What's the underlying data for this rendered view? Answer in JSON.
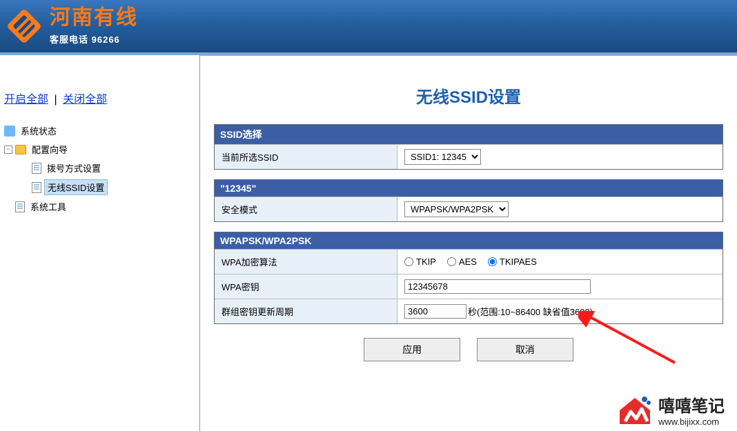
{
  "header": {
    "brand": "河南有线",
    "hotline_label": "客服电话",
    "hotline_number": "96266"
  },
  "sidebar": {
    "expand_all": "开启全部",
    "collapse_all": "关闭全部",
    "nodes": {
      "status": "系统状态",
      "wizard": "配置向导",
      "dial": "拨号方式设置",
      "ssid": "无线SSID设置",
      "tools": "系统工具"
    }
  },
  "main": {
    "title": "无线SSID设置",
    "panel_ssid": {
      "heading": "SSID选择",
      "rows": {
        "current_ssid_label": "当前所选SSID",
        "current_ssid_value": "SSID1: 12345"
      }
    },
    "panel_sec": {
      "heading": "\"12345\"",
      "rows": {
        "sec_mode_label": "安全模式",
        "sec_mode_value": "WPAPSK/WPA2PSK"
      }
    },
    "panel_wpa": {
      "heading": "WPAPSK/WPA2PSK",
      "rows": {
        "algo_label": "WPA加密算法",
        "algo_options": {
          "tkip": "TKIP",
          "aes": "AES",
          "tkipaes": "TKIPAES"
        },
        "key_label": "WPA密钥",
        "key_value": "12345678",
        "rekey_label": "群组密钥更新周期",
        "rekey_value": "3600",
        "rekey_hint": "秒(范围:10~86400 缺省值3600)"
      }
    },
    "buttons": {
      "apply": "应用",
      "cancel": "取消"
    }
  },
  "watermark": {
    "cn": "嘻嘻笔记",
    "url": "www.bijixx.com"
  }
}
